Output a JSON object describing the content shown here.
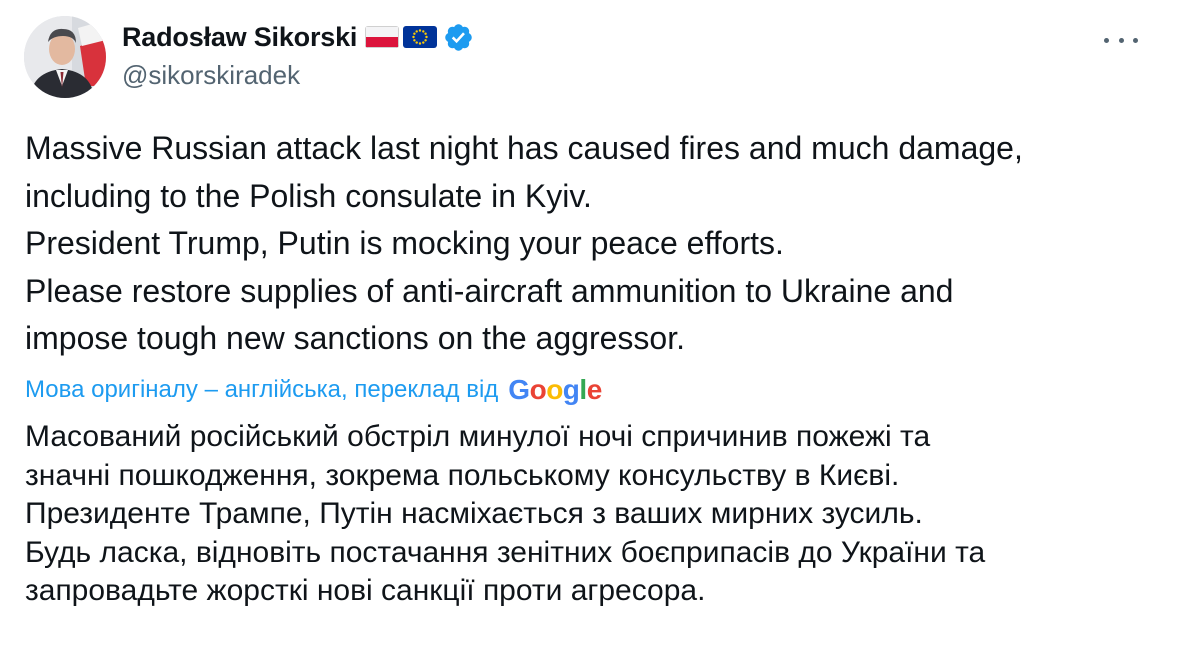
{
  "author": {
    "display_name": "Radosław Sikorski",
    "handle": "@sikorskiradek",
    "flags": [
      "flag-poland-icon",
      "flag-eu-icon"
    ],
    "verified_icon": "verified-badge-icon",
    "verified_color": "#1d9bf0"
  },
  "menu": {
    "icon": "more-options-icon"
  },
  "tweet": {
    "lines": [
      "Massive Russian attack last night has caused fires and much damage,",
      "including to the Polish consulate in Kyiv.",
      "President Trump, Putin is mocking your peace efforts.",
      "Please restore supplies of anti-aircraft ammunition to Ukraine and",
      "impose tough new sanctions on the aggressor."
    ]
  },
  "translation": {
    "notice": "Мова оригіналу – англійська, переклад від",
    "provider_letters": [
      "G",
      "o",
      "o",
      "g",
      "l",
      "e"
    ],
    "provider_colors": [
      "#4285f4",
      "#ea4335",
      "#fbbc05",
      "#4285f4",
      "#34a853",
      "#ea4335"
    ],
    "lines": [
      "Масований російський обстріл минулої ночі спричинив пожежі та",
      "значні пошкодження, зокрема польському консульству в Києві.",
      "Президенте Трампе, Путін насміхається з ваших мирних зусиль.",
      "Будь ласка, відновіть постачання зенітних боєприпасів до України та",
      "запровадьте жорсткі нові санкції проти агресора."
    ]
  },
  "colors": {
    "link": "#1d9bf0",
    "secondary_text": "#536471",
    "primary_text": "#0f1419"
  }
}
